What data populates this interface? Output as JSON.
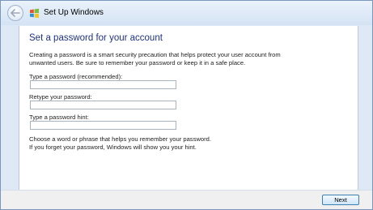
{
  "window": {
    "title": "Set Up Windows"
  },
  "page": {
    "heading": "Set a password for your account",
    "description_lines": [
      "Creating a password is a smart security precaution that helps protect your user account from",
      "unwanted users. Be sure to remember your password or keep it in a safe place."
    ],
    "fields": [
      {
        "label": "Type a password (recommended):",
        "value": ""
      },
      {
        "label": "Retype your password:",
        "value": ""
      },
      {
        "label": "Type a password hint:",
        "value": ""
      }
    ],
    "hint_lines": [
      "Choose a word or phrase that helps you remember your password.",
      "If you forget your password, Windows will show you your hint."
    ]
  },
  "footer": {
    "next_label": "Next"
  },
  "icons": {
    "back": "back-arrow-icon",
    "app": "windows-flag-icon"
  }
}
